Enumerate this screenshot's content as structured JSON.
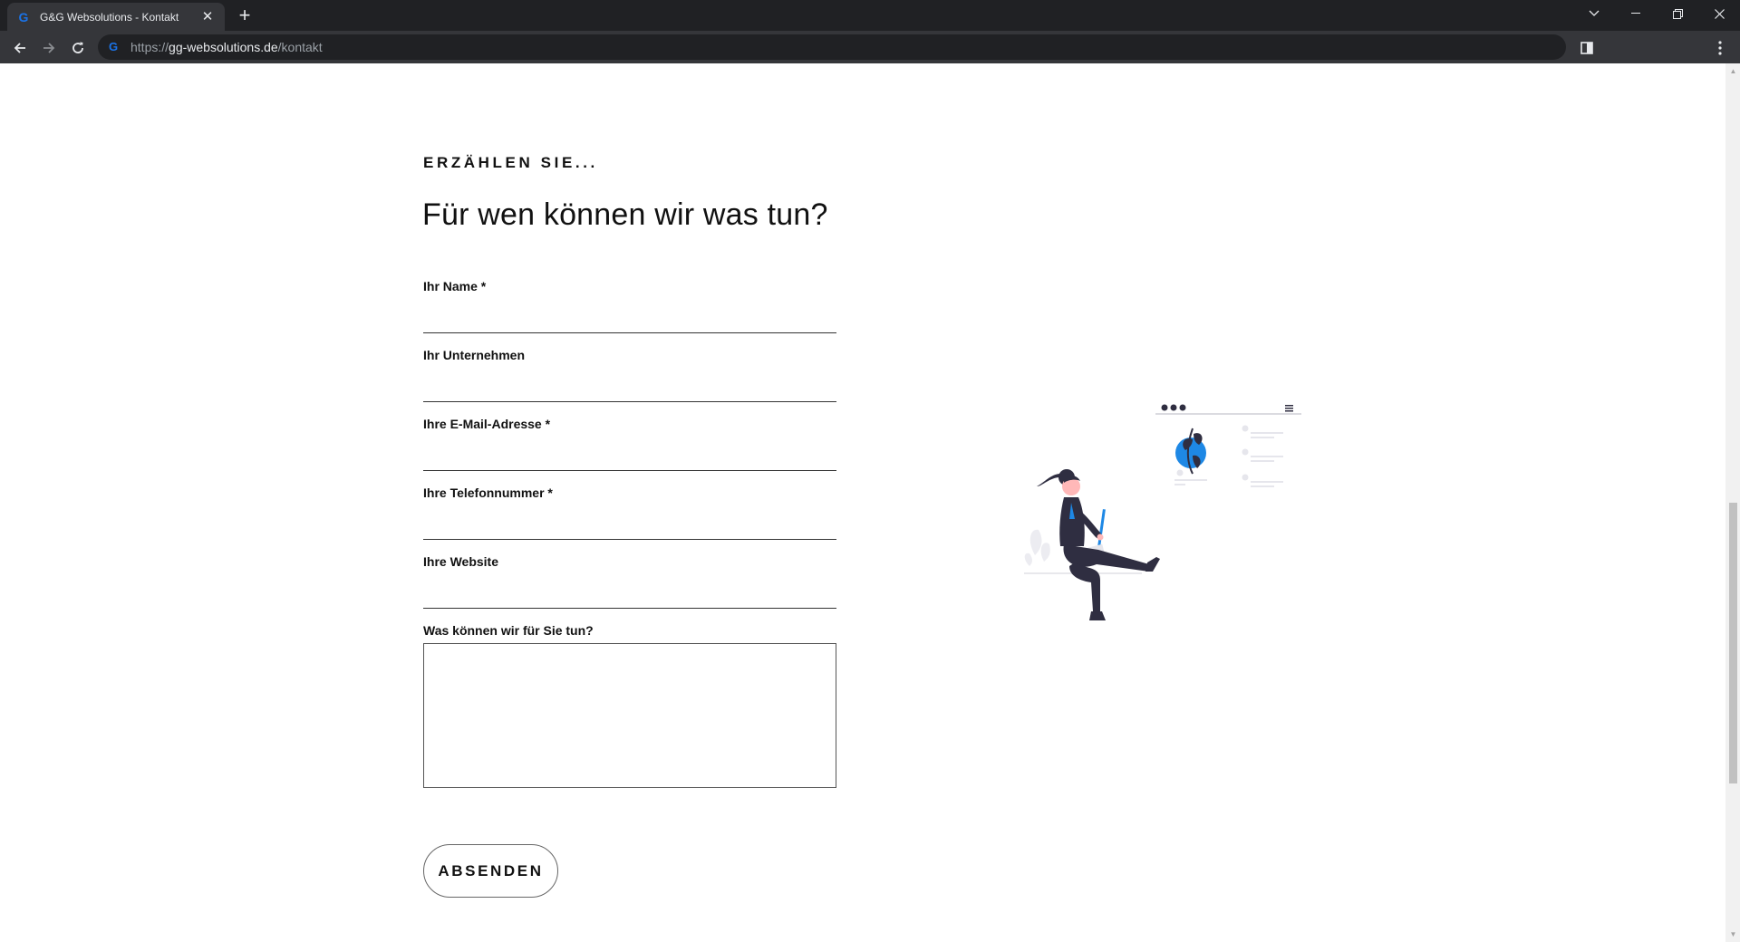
{
  "browser": {
    "tab_title": "G&G Websolutions - Kontakt",
    "tab_favicon": "G",
    "url_scheme": "https://",
    "url_host": "gg-websolutions.de",
    "url_path": "/kontakt"
  },
  "form_section": {
    "eyebrow": "ERZÄHLEN SIE...",
    "headline": "Für wen können wir was tun?",
    "fields": [
      {
        "label": "Ihr Name *",
        "value": ""
      },
      {
        "label": "Ihr Unternehmen",
        "value": ""
      },
      {
        "label": "Ihre E-Mail-Adresse *",
        "value": ""
      },
      {
        "label": "Ihre Telefonnummer *",
        "value": ""
      },
      {
        "label": "Ihre Website",
        "value": ""
      }
    ],
    "message_label": "Was können wir für Sie tun?",
    "message_value": "",
    "submit_label": "ABSENDEN"
  },
  "colors": {
    "accent": "#1a73e8",
    "illustration_blue": "#1e88e5",
    "illustration_dark": "#2f2e41"
  }
}
